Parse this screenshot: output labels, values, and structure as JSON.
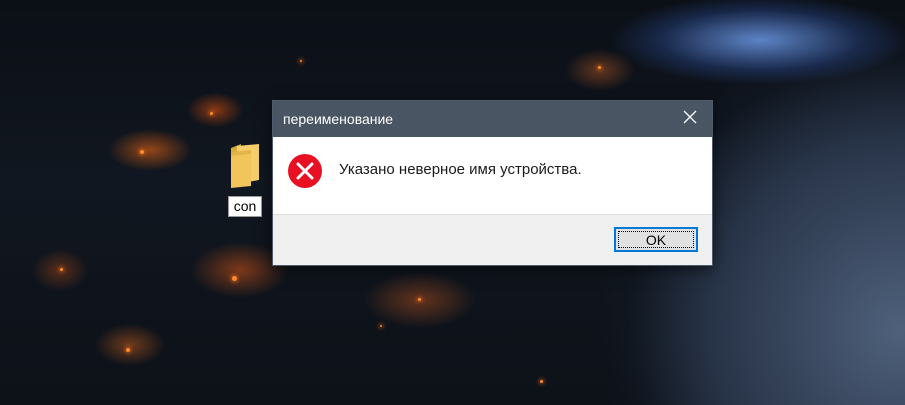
{
  "desktop": {
    "icons": [
      {
        "label": "con",
        "icon": "folder-icon"
      }
    ]
  },
  "dialog": {
    "title": "переименование",
    "close_icon": "close-icon",
    "error_icon": "error-icon",
    "message": "Указано неверное имя устройства.",
    "ok_label": "OK"
  },
  "colors": {
    "titlebar": "#4a5563",
    "error_red": "#e81123",
    "button_focus": "#0078d7",
    "folder": "#f2c55c"
  }
}
